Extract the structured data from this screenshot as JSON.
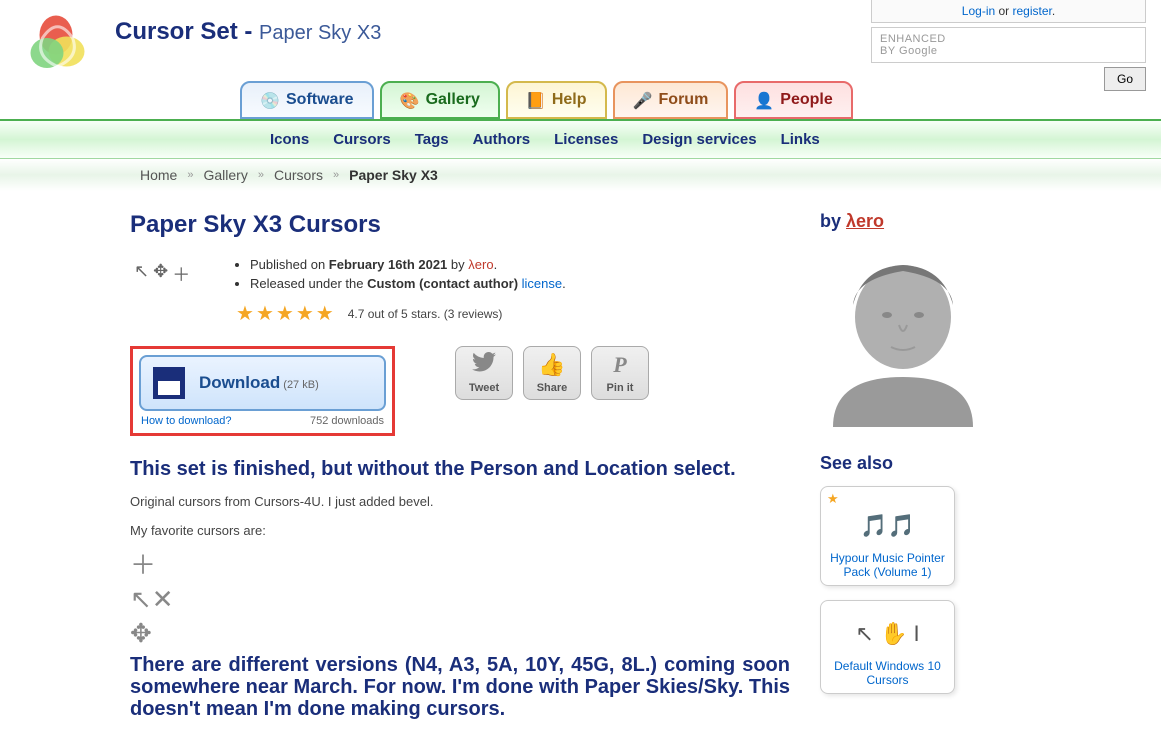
{
  "header": {
    "title_prefix": "Cursor Set - ",
    "title_name": "Paper Sky X3"
  },
  "auth": {
    "login": "Log-in",
    "or": " or ",
    "register": "register",
    "dot": "."
  },
  "search": {
    "prefix_text": "ENHANCED BY Google",
    "placeholder": "",
    "go_label": "Go"
  },
  "tabs": {
    "software": "Software",
    "gallery": "Gallery",
    "help": "Help",
    "forum": "Forum",
    "people": "People"
  },
  "subnav": {
    "icons": "Icons",
    "cursors": "Cursors",
    "tags": "Tags",
    "authors": "Authors",
    "licenses": "Licenses",
    "design_services": "Design services",
    "links": "Links"
  },
  "breadcrumb": {
    "home": "Home",
    "gallery": "Gallery",
    "cursors": "Cursors",
    "current": "Paper Sky X3"
  },
  "page": {
    "h1": "Paper Sky X3 Cursors"
  },
  "meta": {
    "published_prefix": "Published on ",
    "published_date": "February 16th 2021",
    "published_by": " by ",
    "author": "λero",
    "period": ".",
    "released_prefix": "Released under the ",
    "license_name": "Custom (contact author)",
    "license_link": " license",
    "rating_text": "4.7 out of 5 stars. (3 reviews)"
  },
  "download": {
    "label": "Download",
    "size": " (27 kB)",
    "howto": "How to download?",
    "count": "752 downloads"
  },
  "social": {
    "tweet": "Tweet",
    "share": "Share",
    "pin": "Pin it"
  },
  "body": {
    "h3a": "This set is finished, but without the Person and Location select.",
    "p1": "Original cursors from Cursors-4U. I just added bevel.",
    "p2": "My favorite cursors are:",
    "h3b": "There are different versions (N4, A3, 5A, 10Y, 45G, 8L.) coming soon somewhere near March. For now. I'm done with Paper Skies/Sky. This doesn't mean I'm done making cursors."
  },
  "sidebar": {
    "by_label": "by ",
    "author": "λero",
    "see_also": "See also",
    "items": [
      {
        "label": "Hypour Music Pointer Pack (Volume 1)"
      },
      {
        "label": "Default Windows 10 Cursors"
      }
    ]
  }
}
